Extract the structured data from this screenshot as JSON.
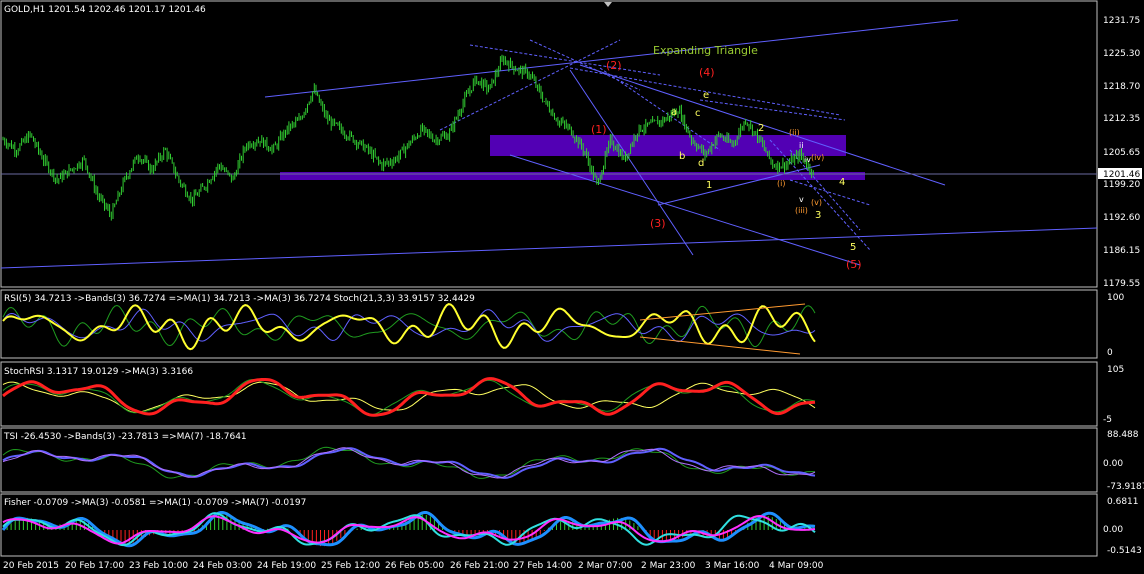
{
  "main_header": "GOLD,H1  1201.54 1202.46 1201.17 1201.46",
  "annotation_title": "Expanding Triangle",
  "current_price_label": "1201.46",
  "colors": {
    "background": "#000000",
    "frame": "#c0c0c0",
    "candle": "#32cd32",
    "trendline": "#6060ff",
    "zone": "#5b00c8",
    "wave_red": "#ff2020",
    "wave_yellow": "#ffff60",
    "wave_orange": "#ff9a30"
  },
  "price_axis": [
    "1231.75",
    "1225.30",
    "1218.70",
    "1212.35",
    "1205.65",
    "1199.20",
    "1192.60",
    "1186.15",
    "1179.55"
  ],
  "time_axis": [
    "20 Feb 2015",
    "20 Feb 17:00",
    "23 Feb 10:00",
    "24 Feb 03:00",
    "24 Feb 19:00",
    "25 Feb 12:00",
    "26 Feb 05:00",
    "26 Feb 21:00",
    "27 Feb 14:00",
    "2 Mar 07:00",
    "2 Mar 23:00",
    "3 Mar 16:00",
    "4 Mar 09:00"
  ],
  "wave_labels": {
    "red": [
      "(1)",
      "(2)",
      "(3)",
      "(4)",
      "(5)"
    ],
    "yellow": [
      "a",
      "b",
      "c",
      "d",
      "e",
      "1",
      "2",
      "3",
      "4",
      "5"
    ],
    "orange": [
      "(i)",
      "(ii)",
      "(iii)",
      "(iv)",
      "(v)",
      "ii",
      "iv",
      "v"
    ]
  },
  "panels": {
    "rsi": {
      "header": "RSI(5) 34.7213  ->Bands(3) 36.7274  =>MA(1) 34.7213  ->MA(3) 36.7274  Stoch(21,3,3) 33.9157 32.4429",
      "axis": [
        "100",
        "0"
      ]
    },
    "stochrsi": {
      "header": "StochRSI 3.1317 19.0129  ->MA(3) 3.3166",
      "axis": [
        "105",
        "-5"
      ]
    },
    "tsi": {
      "header": "TSI -26.4530  ->Bands(3) -23.7813  =>MA(7) -18.7641",
      "axis": [
        "88.488",
        "0.00",
        "-73.9187"
      ]
    },
    "fisher": {
      "header": "Fisher -0.0709  ->MA(3) -0.0581  =>MA(1) -0.0709  ->MA(7) -0.0197",
      "axis": [
        "0.6811",
        "0.00",
        "-0.5143"
      ]
    }
  },
  "chart_data": [
    {
      "type": "candlestick",
      "title": "GOLD,H1",
      "ylim": [
        1179.55,
        1231.75
      ],
      "x": [
        "20 Feb 2015",
        "20 Feb 17:00",
        "23 Feb 10:00",
        "24 Feb 03:00",
        "24 Feb 19:00",
        "25 Feb 12:00",
        "26 Feb 05:00",
        "26 Feb 21:00",
        "27 Feb 14:00",
        "2 Mar 07:00",
        "2 Mar 23:00",
        "3 Mar 16:00",
        "4 Mar 09:00"
      ],
      "close_path": [
        1208,
        1206,
        1209,
        1204,
        1200,
        1202,
        1204,
        1197,
        1193,
        1200,
        1205,
        1202,
        1206,
        1200,
        1196,
        1199,
        1203,
        1200,
        1207,
        1208,
        1206,
        1210,
        1212,
        1218,
        1212,
        1210,
        1208,
        1206,
        1203,
        1204,
        1207,
        1210,
        1208,
        1209,
        1215,
        1220,
        1218,
        1224,
        1222,
        1221,
        1216,
        1212,
        1210,
        1206,
        1199,
        1208,
        1204,
        1210,
        1211,
        1212,
        1214,
        1208,
        1205,
        1209,
        1207,
        1212,
        1208,
        1203,
        1203,
        1205,
        1201.46
      ],
      "last_close": 1201.46
    },
    {
      "type": "line",
      "title": "RSI(5)",
      "ylim": [
        0,
        100
      ],
      "series": [
        {
          "name": "RSI(5)",
          "last": 34.7213
        },
        {
          "name": "Bands(3)",
          "last": 36.7274
        },
        {
          "name": "Stoch(21,3,3)",
          "last": 33.9157
        }
      ]
    },
    {
      "type": "line",
      "title": "StochRSI",
      "ylim": [
        -5,
        105
      ],
      "series": [
        {
          "name": "StochRSI",
          "last": 3.1317
        },
        {
          "name": "MA(3)",
          "last": 3.3166
        }
      ]
    },
    {
      "type": "line",
      "title": "TSI",
      "ylim": [
        -73.9187,
        88.488
      ],
      "series": [
        {
          "name": "TSI",
          "last": -26.453
        },
        {
          "name": "Bands(3)",
          "last": -23.7813
        },
        {
          "name": "MA(7)",
          "last": -18.7641
        }
      ]
    },
    {
      "type": "line",
      "title": "Fisher",
      "ylim": [
        -0.5143,
        0.6811
      ],
      "series": [
        {
          "name": "Fisher",
          "last": -0.0709
        },
        {
          "name": "MA(3)",
          "last": -0.0581
        },
        {
          "name": "MA(7)",
          "last": -0.0197
        }
      ]
    }
  ]
}
